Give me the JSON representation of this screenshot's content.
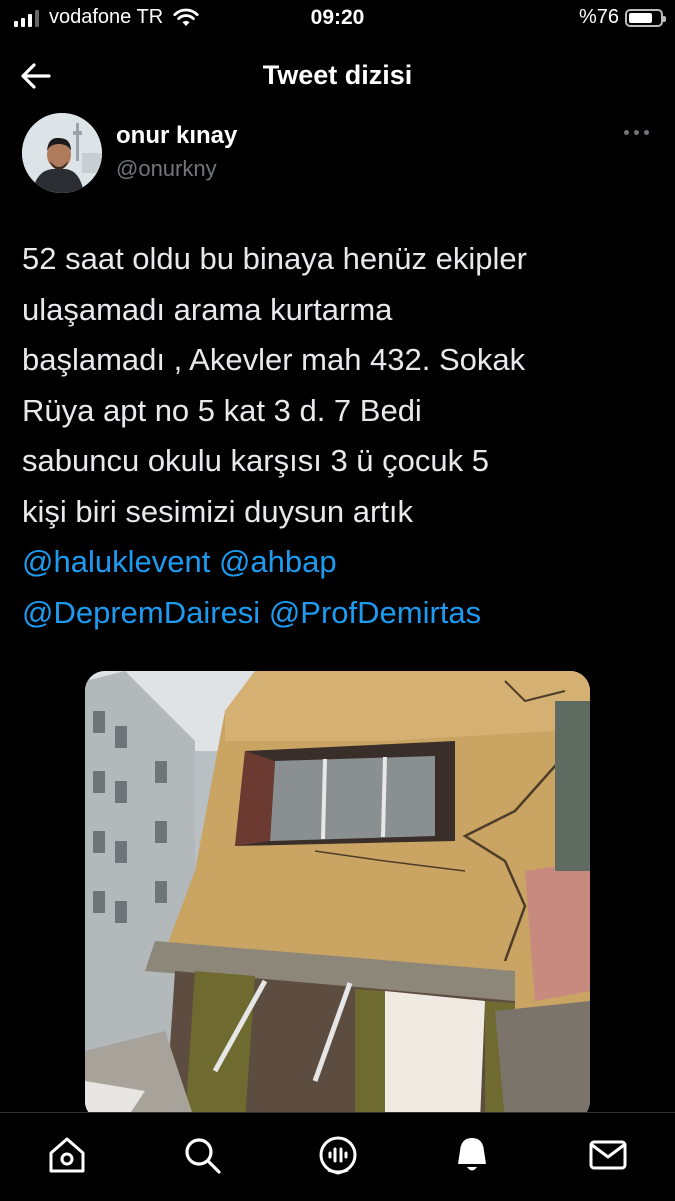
{
  "status_bar": {
    "carrier": "vodafone TR",
    "time": "09:20",
    "battery_label": "%76",
    "battery_level": 0.76
  },
  "header": {
    "title": "Tweet dizisi",
    "back_icon": "arrow-left-icon"
  },
  "author": {
    "name": "onur kınay",
    "handle": "@onurkny"
  },
  "tweet": {
    "lines": [
      "52 saat oldu bu binaya henüz ekipler",
      "ulaşamadı arama kurtarma",
      "başlamadı , Akevler mah 432. Sokak",
      "Rüya apt no 5 kat 3 d. 7 Bedi",
      "sabuncu okulu karşısı 3 ü çocuk 5",
      "kişi biri sesimizi duysun artık"
    ],
    "mentions": [
      "@haluklevent",
      "@ahbap",
      "@DepremDairesi",
      "@ProfDemirtas"
    ]
  },
  "tabs": [
    {
      "icon": "home-icon"
    },
    {
      "icon": "search-icon"
    },
    {
      "icon": "spaces-icon"
    },
    {
      "icon": "notifications-icon"
    },
    {
      "icon": "messages-icon"
    }
  ],
  "colors": {
    "background": "#000000",
    "link": "#1d9bf0",
    "text": "#e7e9ea",
    "secondary": "#71767b"
  }
}
